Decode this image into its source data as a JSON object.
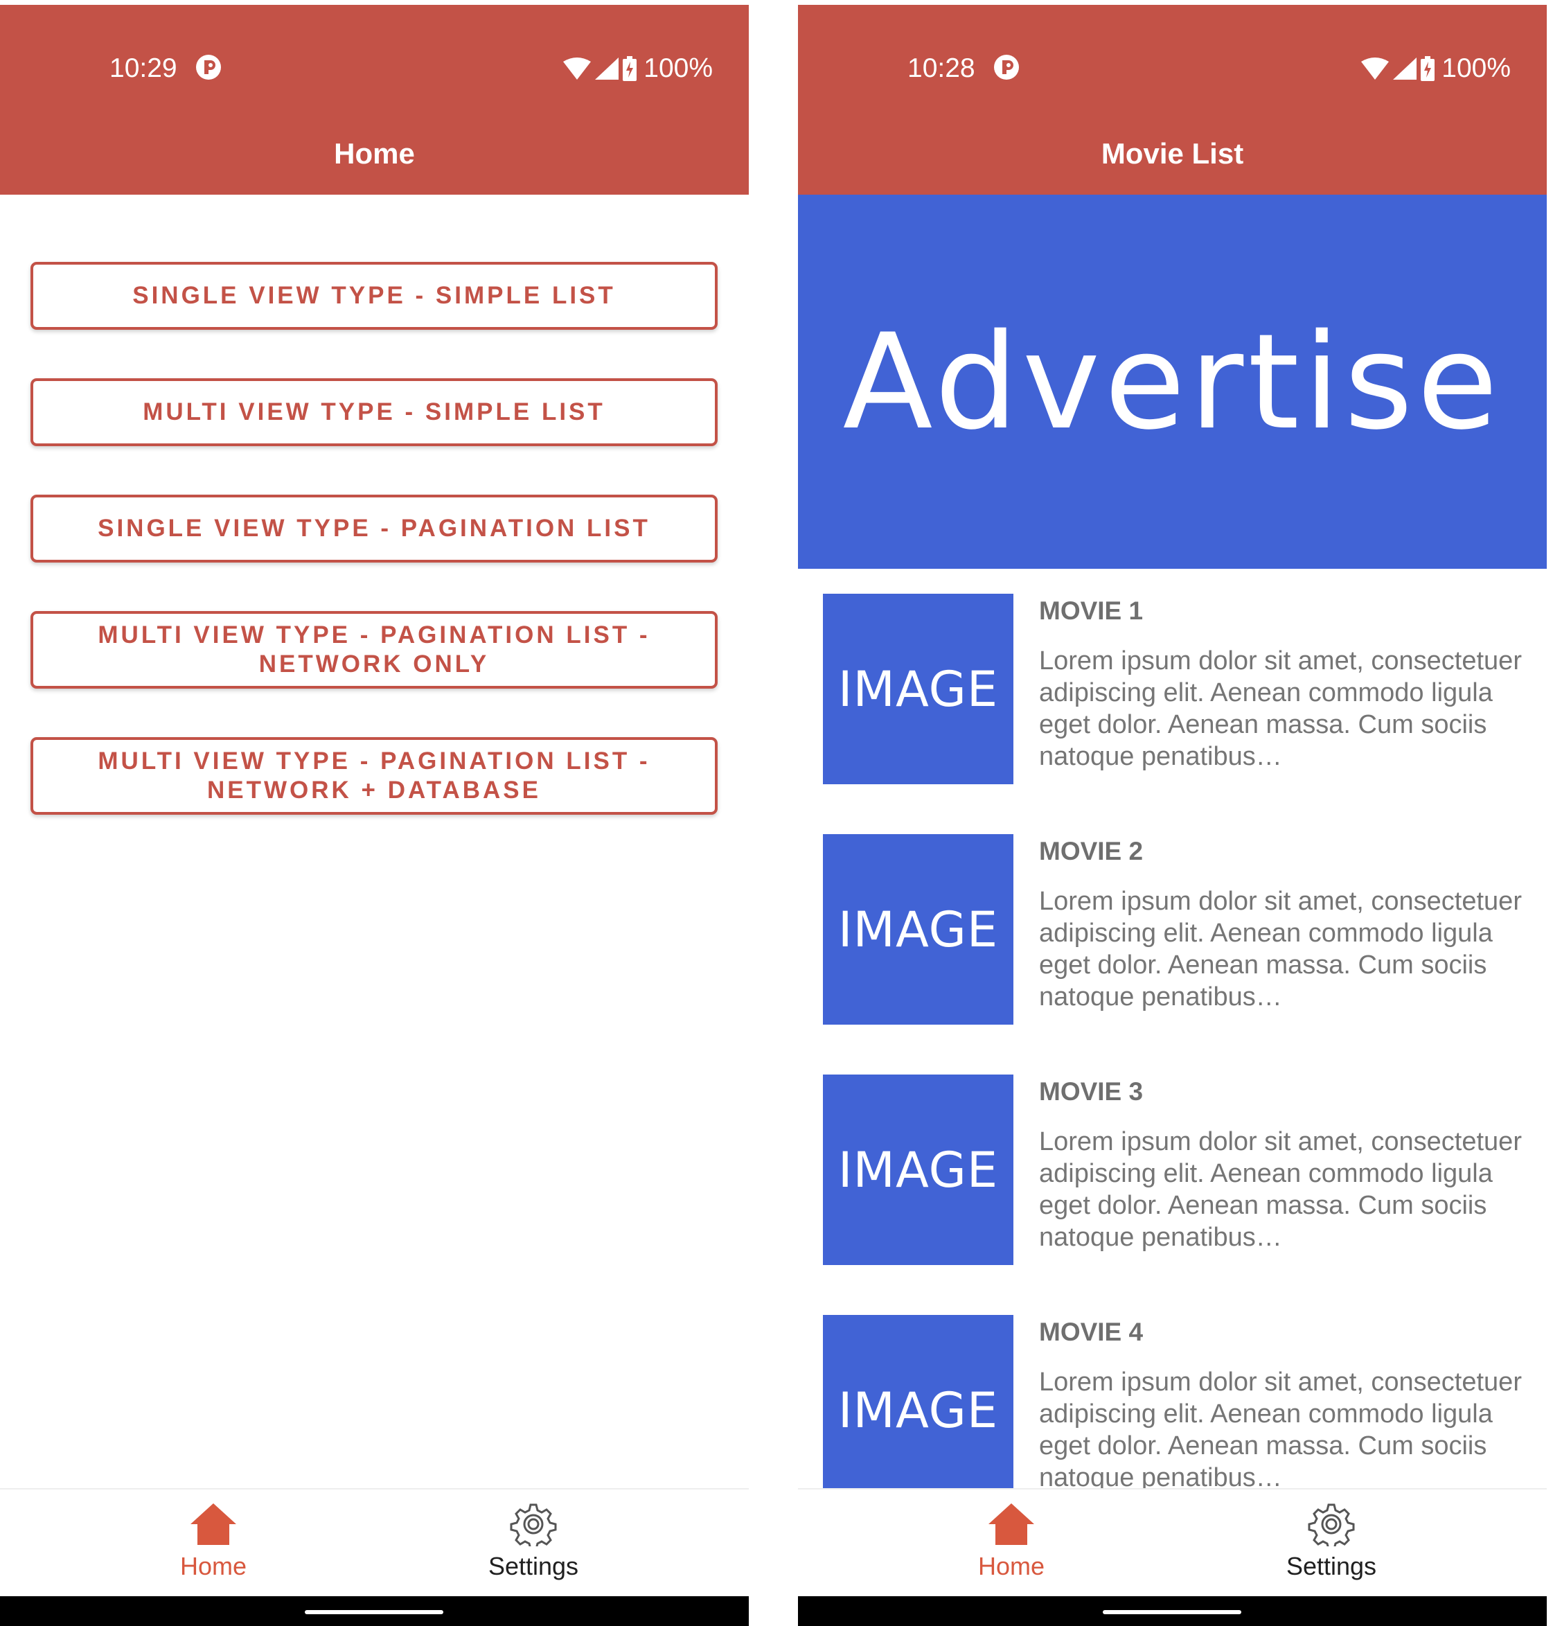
{
  "colors": {
    "accent": "#c35247",
    "ad_blue": "#4163d5",
    "nav_active": "#d8583e"
  },
  "left_screen": {
    "status": {
      "time": "10:29",
      "battery": "100%"
    },
    "title": "Home",
    "buttons": [
      {
        "lines": [
          "SINGLE VIEW TYPE - SIMPLE LIST"
        ]
      },
      {
        "lines": [
          "MULTI VIEW TYPE - SIMPLE LIST"
        ]
      },
      {
        "lines": [
          "SINGLE VIEW TYPE - PAGINATION LIST"
        ]
      },
      {
        "lines": [
          "MULTI VIEW TYPE - PAGINATION LIST -",
          "NETWORK ONLY"
        ]
      },
      {
        "lines": [
          "MULTI VIEW TYPE - PAGINATION LIST -",
          "NETWORK + DATABASE"
        ]
      }
    ],
    "nav": {
      "home": "Home",
      "settings": "Settings",
      "active": "home"
    }
  },
  "right_screen": {
    "status": {
      "time": "10:28",
      "battery": "100%"
    },
    "title": "Movie List",
    "ad_text": "Advertise",
    "image_placeholder": "IMAGE",
    "movies": [
      {
        "title": "MOVIE 1",
        "desc": "Lorem ipsum dolor sit amet, consectetuer adipiscing elit. Aenean commodo ligula eget dolor. Aenean massa. Cum sociis natoque penatibus…"
      },
      {
        "title": "MOVIE 2",
        "desc": "Lorem ipsum dolor sit amet, consectetuer adipiscing elit. Aenean commodo ligula eget dolor. Aenean massa. Cum sociis natoque penatibus…"
      },
      {
        "title": "MOVIE 3",
        "desc": "Lorem ipsum dolor sit amet, consectetuer adipiscing elit. Aenean commodo ligula eget dolor. Aenean massa. Cum sociis natoque penatibus…"
      },
      {
        "title": "MOVIE 4",
        "desc": "Lorem ipsum dolor sit amet, consectetuer adipiscing elit. Aenean commodo ligula eget dolor. Aenean massa. Cum sociis natoque penatibus…"
      }
    ],
    "nav": {
      "home": "Home",
      "settings": "Settings",
      "active": "home"
    }
  },
  "icons": {
    "cast": "cast-icon",
    "wifi": "wifi-icon",
    "signal": "signal-icon",
    "battery": "battery-charging-icon",
    "home": "home-icon",
    "settings": "gear-icon"
  }
}
